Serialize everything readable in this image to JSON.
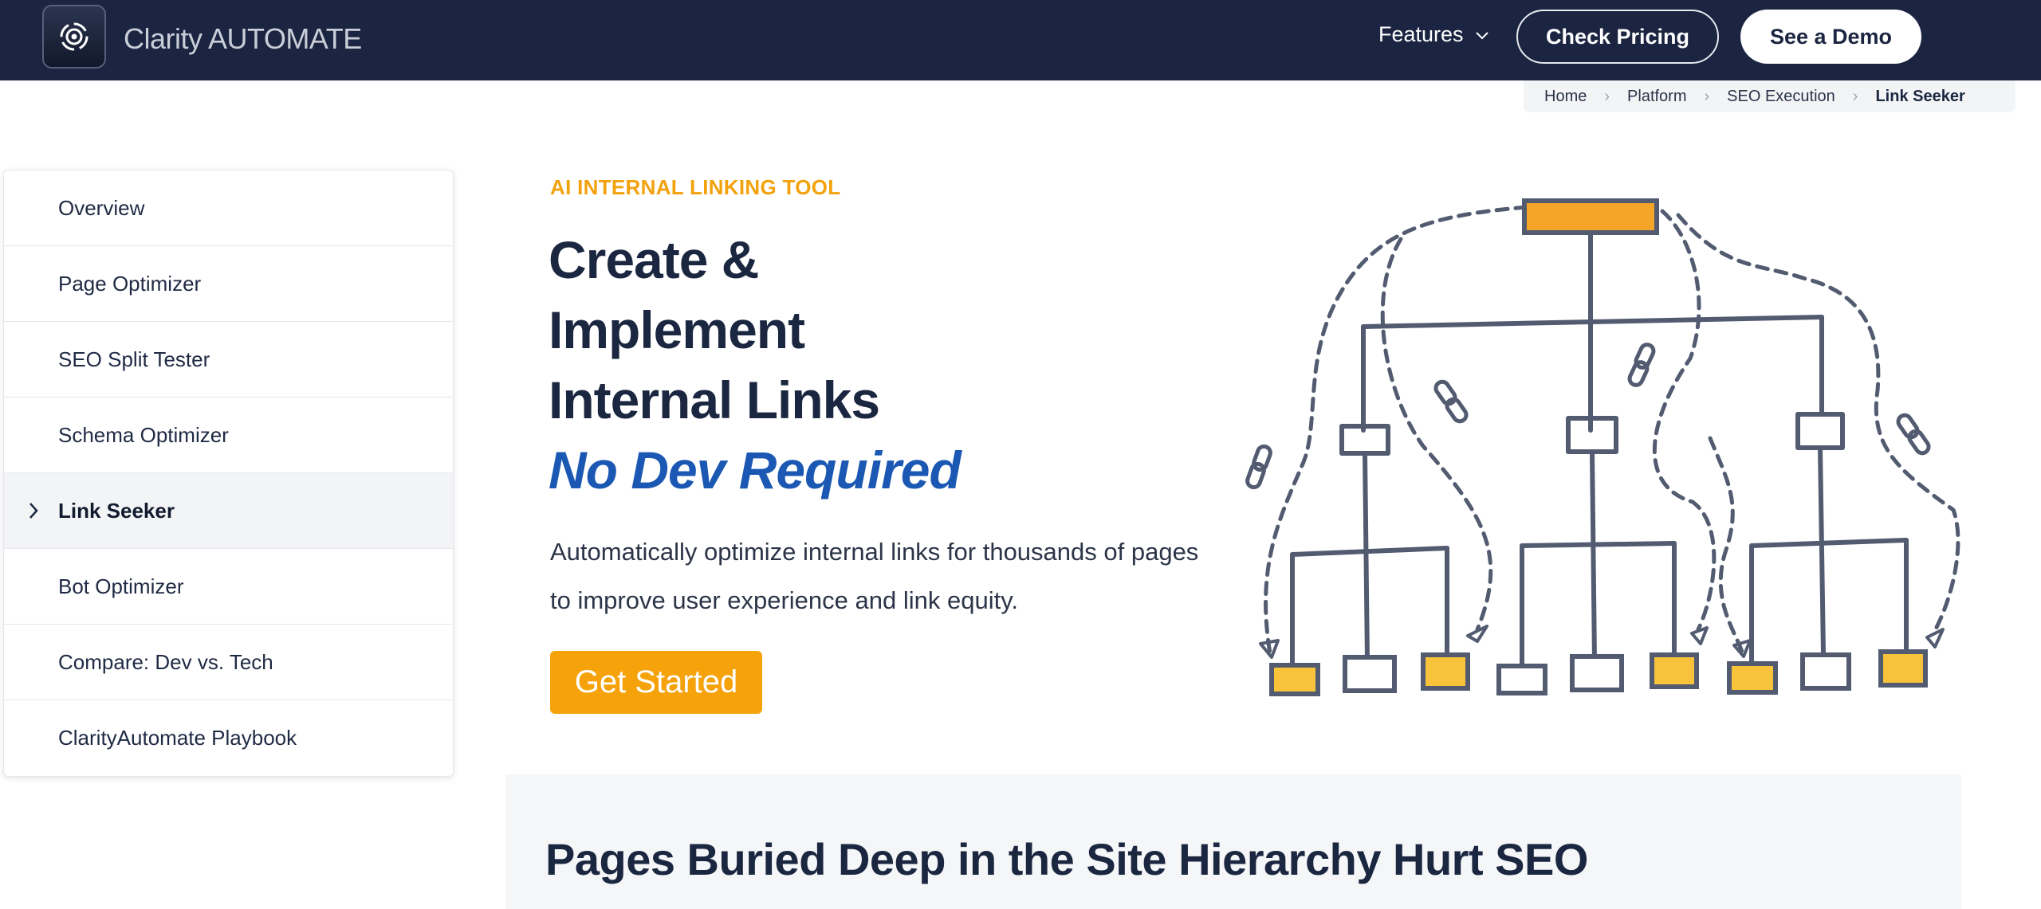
{
  "header": {
    "brand_name": "Clarity",
    "brand_suffix": "AUTOMATE",
    "logo_icon": "gear-logo-icon",
    "nav_features": "Features",
    "check_pricing": "Check Pricing",
    "see_demo": "See a Demo"
  },
  "breadcrumb": {
    "items": [
      "Home",
      "Platform",
      "SEO Execution",
      "Link Seeker"
    ]
  },
  "sidebar": {
    "items": [
      {
        "label": "Overview"
      },
      {
        "label": "Page Optimizer"
      },
      {
        "label": "SEO Split Tester"
      },
      {
        "label": "Schema Optimizer"
      },
      {
        "label": "Link Seeker",
        "active": true
      },
      {
        "label": "Bot Optimizer"
      },
      {
        "label": "Compare: Dev vs. Tech"
      },
      {
        "label": "ClarityAutomate Playbook"
      }
    ]
  },
  "hero": {
    "eyebrow": "AI INTERNAL LINKING TOOL",
    "title_line1": "Create &",
    "title_line2": "Implement",
    "title_line3": "Internal Links",
    "title_accent": "No Dev Required",
    "subtitle": "Automatically optimize internal links for thousands of pages to improve user experience and link equity.",
    "cta": "Get Started"
  },
  "section": {
    "title": "Pages Buried Deep in the Site Hierarchy Hurt SEO"
  },
  "colors": {
    "nav_bg": "#1b2541",
    "accent_orange": "#f5a20b",
    "accent_blue": "#1a58b3",
    "text_dark": "#1b2740"
  }
}
